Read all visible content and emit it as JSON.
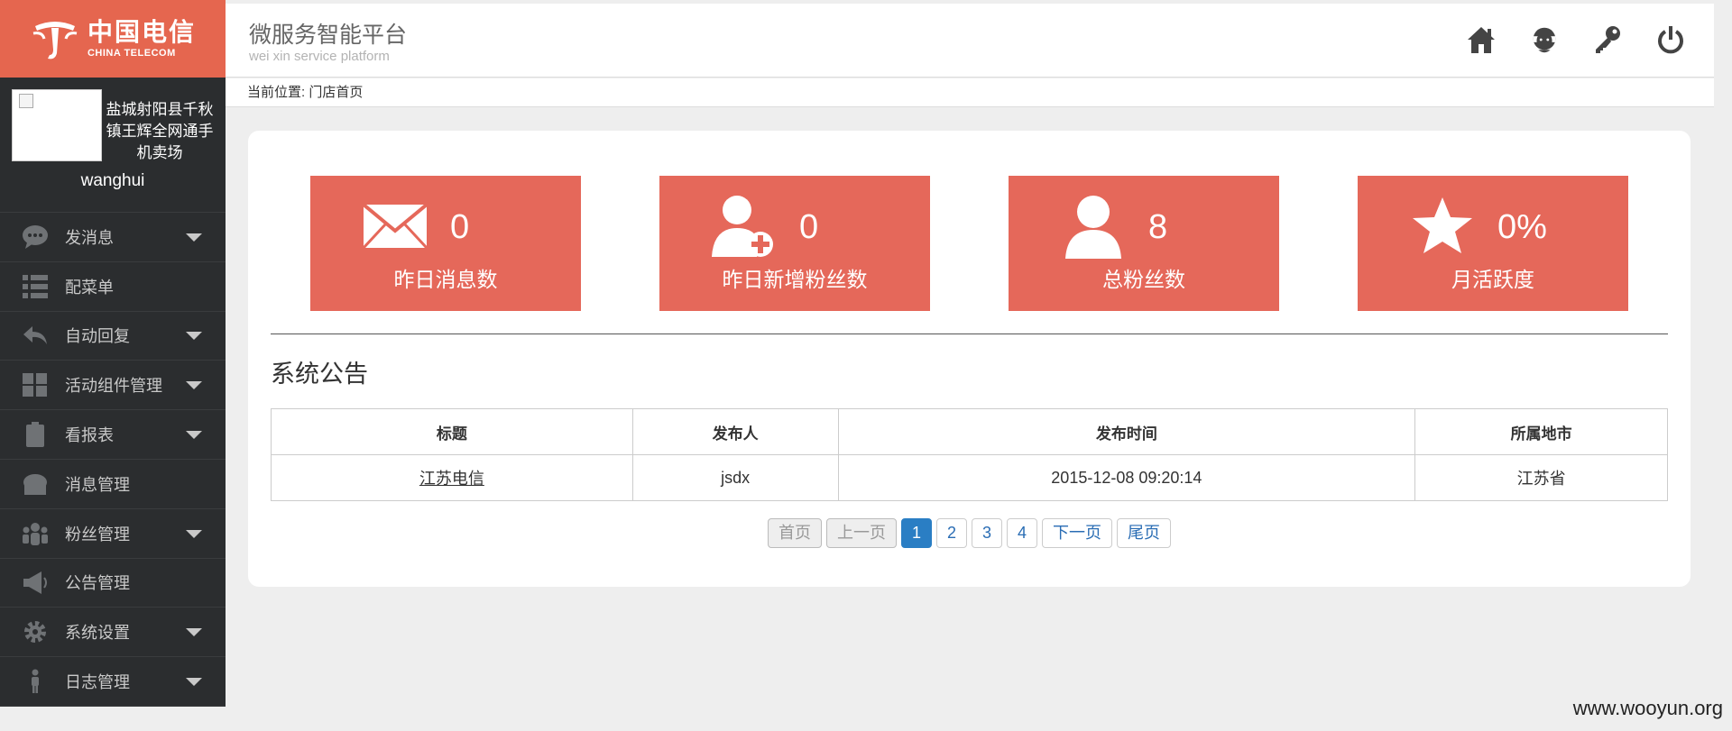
{
  "logo": {
    "cn": "中国电信",
    "en": "CHINA TELECOM"
  },
  "profile": {
    "store_name": "盐城射阳县千秋镇王辉全网通手机卖场",
    "username": "wanghui"
  },
  "sidebar": {
    "items": [
      {
        "label": "发消息",
        "icon": "chat-bubble-icon",
        "has_caret": true
      },
      {
        "label": "配菜单",
        "icon": "list-icon",
        "has_caret": false
      },
      {
        "label": "自动回复",
        "icon": "reply-arrow-icon",
        "has_caret": true
      },
      {
        "label": "活动组件管理",
        "icon": "grid-icon",
        "has_caret": true
      },
      {
        "label": "看报表",
        "icon": "clipboard-icon",
        "has_caret": true
      },
      {
        "label": "消息管理",
        "icon": "cake-icon",
        "has_caret": false
      },
      {
        "label": "粉丝管理",
        "icon": "users-icon",
        "has_caret": true
      },
      {
        "label": "公告管理",
        "icon": "megaphone-icon",
        "has_caret": false
      },
      {
        "label": "系统设置",
        "icon": "gear-icon",
        "has_caret": true
      },
      {
        "label": "日志管理",
        "icon": "person-icon",
        "has_caret": true
      }
    ]
  },
  "header": {
    "title": "微服务智能平台",
    "subtitle": "wei xin service platform",
    "icons": [
      "home-icon",
      "support-agent-icon",
      "key-icon",
      "power-icon"
    ]
  },
  "breadcrumb": {
    "text": "当前位置: 门店首页"
  },
  "stats": [
    {
      "value": "0",
      "label": "昨日消息数",
      "icon": "envelope-icon"
    },
    {
      "value": "0",
      "label": "昨日新增粉丝数",
      "icon": "add-user-icon"
    },
    {
      "value": "8",
      "label": "总粉丝数",
      "icon": "user-icon"
    },
    {
      "value": "0%",
      "label": "月活跃度",
      "icon": "star-icon"
    }
  ],
  "notice": {
    "heading": "系统公告",
    "columns": [
      "标题",
      "发布人",
      "发布时间",
      "所属地市"
    ],
    "rows": [
      {
        "title": "江苏电信",
        "publisher": "jsdx",
        "time": "2015-12-08 09:20:14",
        "city": "江苏省"
      }
    ]
  },
  "pagination": {
    "first": "首页",
    "prev": "上一页",
    "pages": [
      "1",
      "2",
      "3",
      "4"
    ],
    "current": "1",
    "next": "下一页",
    "last": "尾页"
  },
  "watermark": "www.wooyun.org",
  "colors": {
    "brand": "#e5664f",
    "stat_bg": "#e5685a",
    "sidebar_bg": "#2b2d2f",
    "link_blue": "#2a7ec4"
  }
}
